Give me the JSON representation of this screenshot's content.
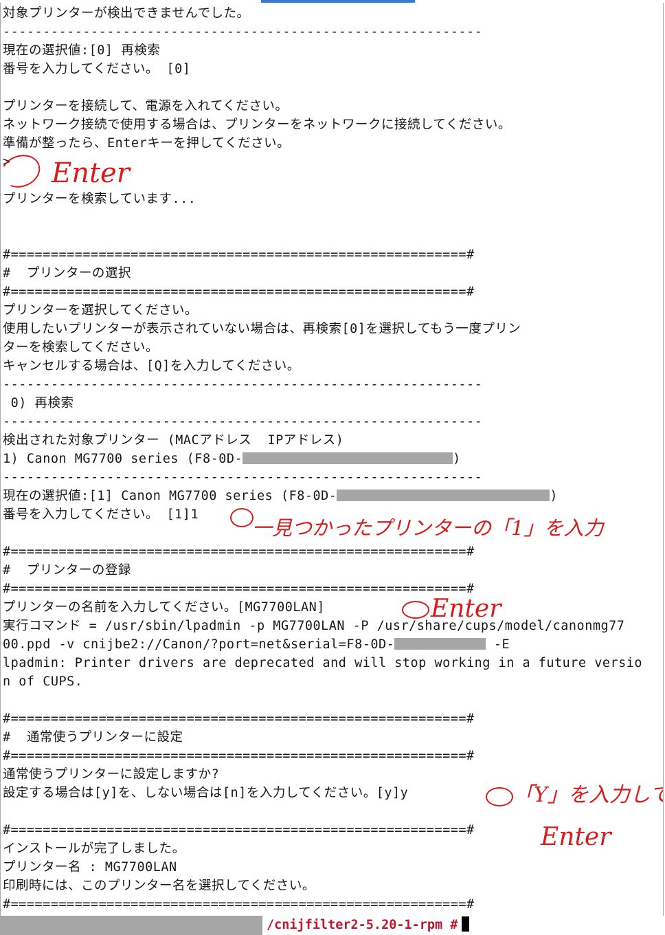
{
  "terminal": {
    "lines": [
      "対象プリンターが検出できませんでした。",
      "------------------------------------------------------------",
      "現在の選択値:[0] 再検索",
      "番号を入力してください。 [0]",
      "",
      "プリンターを接続して、電源を入れてください。",
      "ネットワーク接続で使用する場合は、プリンターをネットワークに接続してください。",
      "準備が整ったら、Enterキーを押してください。",
      ">",
      "",
      "プリンターを検索しています...",
      "",
      "",
      "#=========================================================#",
      "#  プリンターの選択",
      "#=========================================================#",
      "プリンターを選択してください。",
      "使用したいプリンターが表示されていない場合は、再検索[0]を選択してもう一度プリン",
      "ターを検索してください。",
      "キャンセルする場合は、[Q]を入力してください。",
      "------------------------------------------------------------",
      " 0) 再検索",
      "------------------------------------------------------------",
      "検出された対象プリンター (MACアドレス  IPアドレス)",
      "",
      "------------------------------------------------------------",
      "",
      "番号を入力してください。 [1]1",
      "",
      "#=========================================================#",
      "#  プリンターの登録",
      "#=========================================================#",
      "プリンターの名前を入力してください。[MG7700LAN]",
      "実行コマンド = /usr/sbin/lpadmin -p MG7700LAN -P /usr/share/cups/model/canonmg77",
      "",
      "lpadmin: Printer drivers are deprecated and will stop working in a future versio",
      "n of CUPS.",
      "",
      "#=========================================================#",
      "#  通常使うプリンターに設定",
      "#=========================================================#",
      "通常使うプリンターに設定しますか?",
      "設定する場合は[y]を、しない場合は[n]を入力してください。[y]y",
      "",
      "#=========================================================#",
      "インストールが完了しました。",
      "プリンター名 : MG7700LAN",
      "印刷時には、このプリンター名を選択してください。",
      "#=========================================================#"
    ],
    "printer_line_prefix": "1) Canon MG7700 series (F8-0D-",
    "printer_line_suffix": ")",
    "current_selection_prefix": "現在の選択値:[1] Canon MG7700 series (F8-0D-",
    "current_selection_suffix": ")",
    "ppd_line_prefix": "00.ppd -v cnijbe2://Canon/?port=net&serial=F8-0D-",
    "ppd_line_suffix": " -E"
  },
  "annotations": {
    "enter_1": "Enter",
    "select_note": "一見つかったプリンターの「1」を入力",
    "enter_2": "Enter",
    "y_note": "「Y」を入力して",
    "enter_3": "Enter"
  },
  "status_bar": {
    "prompt": "/cnijfilter2-5.20-1-rpm #"
  },
  "colors": {
    "annotation_red": "#d81b1b",
    "prompt_red": "#c0162b",
    "redaction_gray": "#a6a6a6"
  }
}
